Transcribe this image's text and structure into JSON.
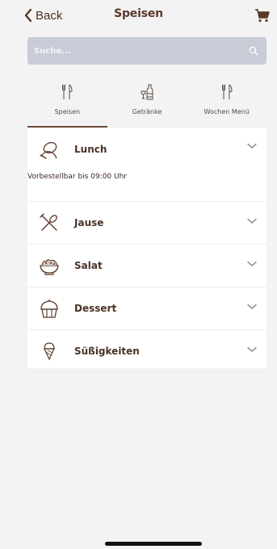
{
  "header": {
    "back_label": "Back",
    "title": "Speisen"
  },
  "search": {
    "placeholder": "Suche..."
  },
  "tabs": [
    {
      "label": "Speisen",
      "icon": "cutlery-icon",
      "active": true
    },
    {
      "label": "Getränke",
      "icon": "drinks-icon",
      "active": false
    },
    {
      "label": "Wochen Menü",
      "icon": "cutlery-icon",
      "active": false
    }
  ],
  "categories": [
    {
      "name": "Lunch",
      "icon": "lunch-icon",
      "note": "Vorbestellbar bis 09:00 Uhr"
    },
    {
      "name": "Jause",
      "icon": "spatula-icon"
    },
    {
      "name": "Salat",
      "icon": "salad-bowl-icon"
    },
    {
      "name": "Dessert",
      "icon": "cupcake-icon"
    },
    {
      "name": "Süßigkeiten",
      "icon": "ice-cream-icon"
    }
  ],
  "colors": {
    "accent": "#6b4a38",
    "search_bg": "#c7ccd7",
    "background": "#f3f3f3"
  }
}
